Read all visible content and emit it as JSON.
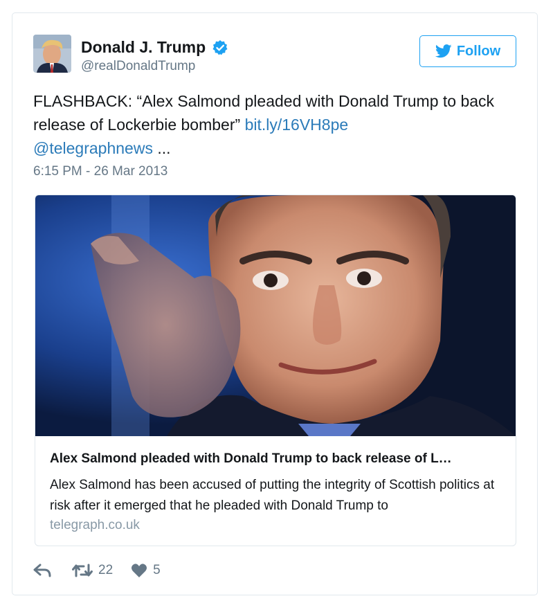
{
  "author": {
    "name": "Donald J. Trump",
    "handle": "@realDonaldTrump",
    "verified": true
  },
  "follow_button": {
    "label": "Follow",
    "color": "#1da1f2"
  },
  "tweet": {
    "text_main": "FLASHBACK: “Alex Salmond pleaded with Donald Trump to back release of Lockerbie bomber”",
    "link": "bit.ly/16VH8pe",
    "mention": "@telegraphnews",
    "ellipsis": "...",
    "timestamp": "6:15 PM - 26 Mar 2013"
  },
  "card": {
    "title": "Alex Salmond pleaded with Donald Trump to back release of L…",
    "description": "Alex Salmond has been accused of putting the integrity of Scottish politics at risk after it emerged that he pleaded with Donald Trump to",
    "domain": "telegraph.co.uk"
  },
  "actions": {
    "reply_icon": "reply-icon",
    "retweet_icon": "retweet-icon",
    "retweet_count": "22",
    "like_icon": "heart-icon",
    "like_count": "5"
  },
  "colors": {
    "link": "#2b7bb9",
    "muted": "#657786",
    "border": "#e1e8ed"
  }
}
